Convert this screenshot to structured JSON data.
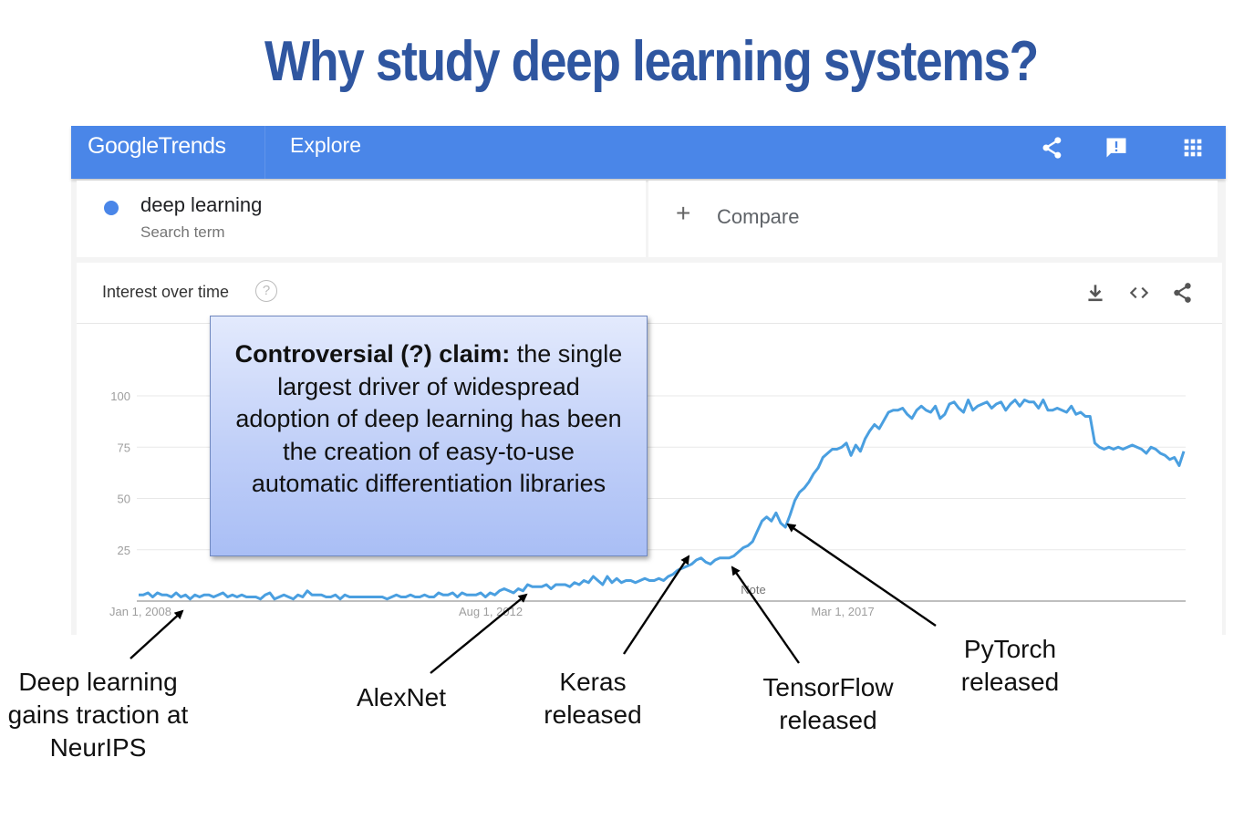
{
  "slide": {
    "title": "Why study deep learning systems?"
  },
  "header": {
    "logo_google": "Google",
    "logo_trends": "Trends",
    "nav_label": "Explore",
    "icons": [
      "share-icon",
      "feedback-icon",
      "apps-grid-icon"
    ]
  },
  "search": {
    "term": "deep learning",
    "term_type": "Search term",
    "term_color": "#4a86e8",
    "compare_label": "Compare"
  },
  "chart_panel": {
    "title": "Interest over time",
    "help_glyph": "?",
    "icons": [
      "download-icon",
      "embed-icon",
      "share-icon"
    ]
  },
  "claim": {
    "bold": "Controversial (?) claim:",
    "text": " the single largest driver of widespread adoption of deep learning has been the creation of easy-to-use automatic differentiation libraries"
  },
  "annotations": {
    "neurips": "Deep learning gains traction at NeurIPS",
    "alexnet": "AlexNet",
    "keras": "Keras released",
    "tensorflow": "TensorFlow released",
    "pytorch": "PyTorch released"
  },
  "chart_data": {
    "type": "line",
    "title": "",
    "xlabel": "",
    "ylabel": "",
    "ylim": [
      0,
      100
    ],
    "yticks": [
      25,
      50,
      75,
      100
    ],
    "xtick_labels": [
      "Jan 1, 2008",
      "Aug 1, 2012",
      "Mar 1, 2017"
    ],
    "note_label": "Note",
    "grid": true,
    "line_color": "#4a9fe0",
    "series": [
      {
        "values": [
          3,
          3,
          4,
          2,
          4,
          3,
          3,
          2,
          4,
          2,
          3,
          1,
          3,
          2,
          3,
          3,
          2,
          3,
          4,
          2,
          3,
          2,
          3,
          2,
          2,
          2,
          1,
          3,
          4,
          1,
          2,
          3,
          2,
          1,
          3,
          2,
          5,
          3,
          3,
          3,
          2,
          2,
          3,
          1,
          3,
          2,
          2,
          2,
          2,
          2,
          2,
          2,
          2,
          1,
          2,
          3,
          2,
          2,
          3,
          2,
          2,
          3,
          2,
          2,
          4,
          3,
          3,
          4,
          2,
          4,
          3,
          3,
          3,
          4,
          2,
          4,
          3,
          5,
          6,
          5,
          4,
          6,
          5,
          8,
          7,
          7,
          7,
          8,
          6,
          8,
          8,
          8,
          7,
          9,
          8,
          10,
          9,
          12,
          10,
          8,
          12,
          9,
          11,
          9,
          10,
          10,
          9,
          10,
          11,
          10,
          10,
          11,
          10,
          12,
          13,
          15,
          16,
          17,
          18,
          20,
          21,
          19,
          18,
          20,
          21,
          21,
          21,
          22,
          24,
          26,
          27,
          29,
          34,
          39,
          41,
          39,
          43,
          38,
          36,
          42,
          49,
          53,
          55,
          58,
          62,
          65,
          70,
          72,
          74,
          74,
          75,
          77,
          71,
          76,
          73,
          79,
          83,
          86,
          84,
          88,
          92,
          93,
          93,
          94,
          91,
          89,
          93,
          95,
          93,
          92,
          95,
          89,
          91,
          96,
          97,
          94,
          92,
          98,
          93,
          95,
          96,
          97,
          94,
          96,
          97,
          93,
          96,
          98,
          95,
          98,
          97,
          97,
          94,
          98,
          93,
          93,
          94,
          93,
          92,
          95,
          91,
          92,
          90,
          90,
          77,
          75,
          74,
          75,
          74,
          75,
          74,
          75,
          76,
          75,
          74,
          72,
          75,
          74,
          72,
          71,
          69,
          70,
          66,
          73
        ]
      }
    ]
  }
}
